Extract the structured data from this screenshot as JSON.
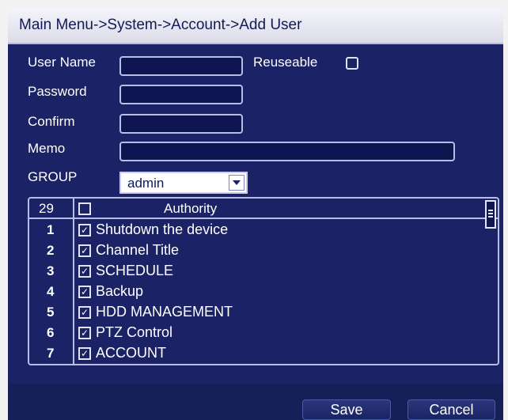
{
  "breadcrumb": "Main Menu->System->Account->Add User",
  "form": {
    "user_name_label": "User Name",
    "reuseable_label": "Reuseable",
    "password_label": "Password",
    "confirm_label": "Confirm",
    "memo_label": "Memo",
    "group_label": "GROUP",
    "group_value": "admin"
  },
  "authority": {
    "count": "29",
    "header": "Authority",
    "rows": [
      {
        "num": "1",
        "label": "Shutdown the device",
        "checked": true
      },
      {
        "num": "2",
        "label": "Channel Title",
        "checked": true
      },
      {
        "num": "3",
        "label": "SCHEDULE",
        "checked": true
      },
      {
        "num": "4",
        "label": "Backup",
        "checked": true
      },
      {
        "num": "5",
        "label": "HDD MANAGEMENT",
        "checked": true
      },
      {
        "num": "6",
        "label": "PTZ Control",
        "checked": true
      },
      {
        "num": "7",
        "label": "ACCOUNT",
        "checked": true
      }
    ]
  },
  "buttons": {
    "save": "Save",
    "cancel": "Cancel"
  },
  "colors": {
    "background": "#1b2266",
    "titlebar": "#e8e8f2",
    "border": "#b7bde6"
  }
}
